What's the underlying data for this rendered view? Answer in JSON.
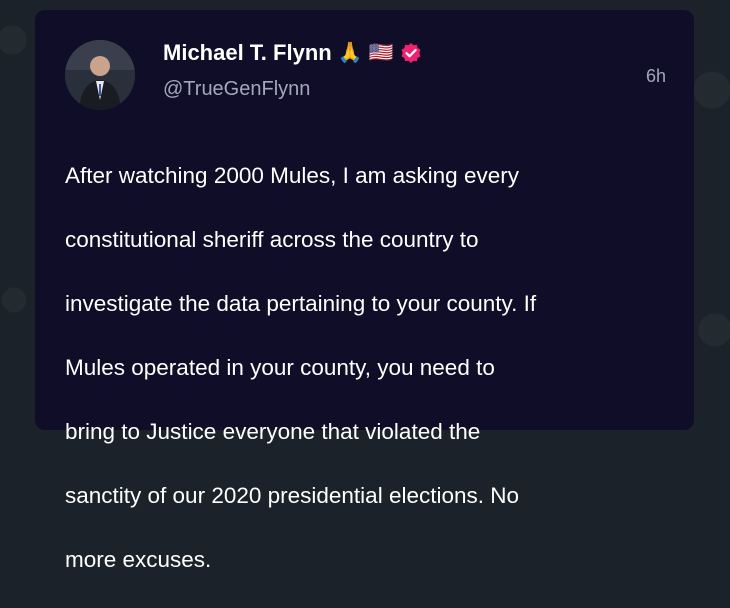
{
  "post": {
    "author_name": "Michael T. Flynn",
    "author_emojis": {
      "hands": "🙏",
      "flag": "🇺🇸"
    },
    "verified_icon": "verified-badge-icon",
    "handle": "@TrueGenFlynn",
    "timestamp": "6h",
    "text_lines": [
      "After watching 2000 Mules, I am asking every",
      "constitutional sheriff across the country to",
      "investigate the data pertaining to your county. If",
      "Mules operated in your county, you need to",
      "bring to Justice everyone that violated the",
      "sanctity of our 2020 presidential elections. No",
      "more excuses."
    ]
  },
  "colors": {
    "card_background": "#0f0d28",
    "page_background": "#1b2229",
    "text_primary": "#ffffff",
    "text_secondary": "#a4a7b9",
    "verified_badge": "#f0246e"
  }
}
